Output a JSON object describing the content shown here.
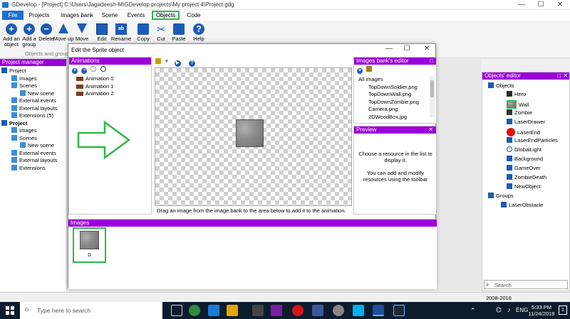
{
  "window": {
    "title": "GDevelop - [Project] C:\\Users\\Jagadeesh-M\\GDevelop projects\\My project 4\\Project.gdg",
    "minimize": "—",
    "maximize": "☐",
    "close": "✕"
  },
  "menu": [
    "File",
    "Projects",
    "Images bank",
    "Scene",
    "Events",
    "Objects",
    "Code"
  ],
  "ribbon": {
    "buttons": [
      {
        "label": "Add an object",
        "icon": "add-icon"
      },
      {
        "label": "Add a group",
        "icon": "add-icon"
      },
      {
        "label": "Delete",
        "icon": "delete-icon"
      },
      {
        "label": "Move up",
        "icon": "arrow-up-icon"
      },
      {
        "label": "Move",
        "icon": "arrow-down-icon"
      },
      {
        "label": "Edit",
        "icon": "edit-icon"
      },
      {
        "label": "Rename",
        "icon": "rename-icon"
      },
      {
        "label": "Copy",
        "icon": "copy-icon"
      },
      {
        "label": "Cut",
        "icon": "cut-icon"
      },
      {
        "label": "Paste",
        "icon": "paste-icon"
      },
      {
        "label": "Help",
        "icon": "help-icon"
      }
    ],
    "group_label": "Objects and groups"
  },
  "project_manager": {
    "title": "Project manager",
    "items": [
      {
        "label": "Project",
        "level": 0,
        "bold": false
      },
      {
        "label": "Images",
        "level": 1
      },
      {
        "label": "Scenes",
        "level": 1
      },
      {
        "label": "New scene",
        "level": 2
      },
      {
        "label": "External events",
        "level": 1
      },
      {
        "label": "External layouts",
        "level": 1
      },
      {
        "label": "Extensions (5)",
        "level": 1
      },
      {
        "label": "Project",
        "level": 0,
        "bold": true
      },
      {
        "label": "Images",
        "level": 1
      },
      {
        "label": "Scenes",
        "level": 1
      },
      {
        "label": "New scene",
        "level": 2
      },
      {
        "label": "External events",
        "level": 1
      },
      {
        "label": "External layouts",
        "level": 1
      },
      {
        "label": "Extensions",
        "level": 1
      }
    ]
  },
  "dialog": {
    "title": "Edit the Sprite object",
    "animations_title": "Animations",
    "animations": [
      "Animation 0",
      "Animation 1",
      "Animation 2"
    ],
    "canvas_hint": "Drag an image from the image bank to the area below to add it to the animation.",
    "images_title": "Images",
    "images": [
      {
        "index": "0"
      }
    ],
    "images_bank_title": "Images bank's editor",
    "images_bank_root": "All images",
    "images_bank_items": [
      "TopDownSoldier.png",
      "TopDownWall.png",
      "TopDownZombie.png",
      "Camera.png",
      "2DWoodBox.jpg"
    ],
    "preview_title": "Preview",
    "preview_text_1": "Choose a resource in the list to display it.",
    "preview_text_2": "You can add and modify resources using the toolbar"
  },
  "objects_editor": {
    "title": "Objects' editor",
    "root": "Objects",
    "objects": [
      "Hero",
      "Wall",
      "Zombie",
      "LaserDrawer",
      "LaserEnd",
      "LaserEndParticles",
      "GlobalLight",
      "Background",
      "GameOver",
      "ZombieDeath",
      "NewObject"
    ],
    "groups_label": "Groups",
    "groups": [
      "LaserObstacle"
    ],
    "search_placeholder": "Search"
  },
  "status": {
    "copyright": "2008-2016"
  },
  "taskbar": {
    "search_placeholder": "Type here to search",
    "language": "ENG",
    "time": "5:33 PM",
    "date": "11/24/2019",
    "notification_count": "1"
  },
  "colors": {
    "panel_header": "#9b00d9",
    "highlight": "#2db84a",
    "accent": "#1e6fd1"
  }
}
